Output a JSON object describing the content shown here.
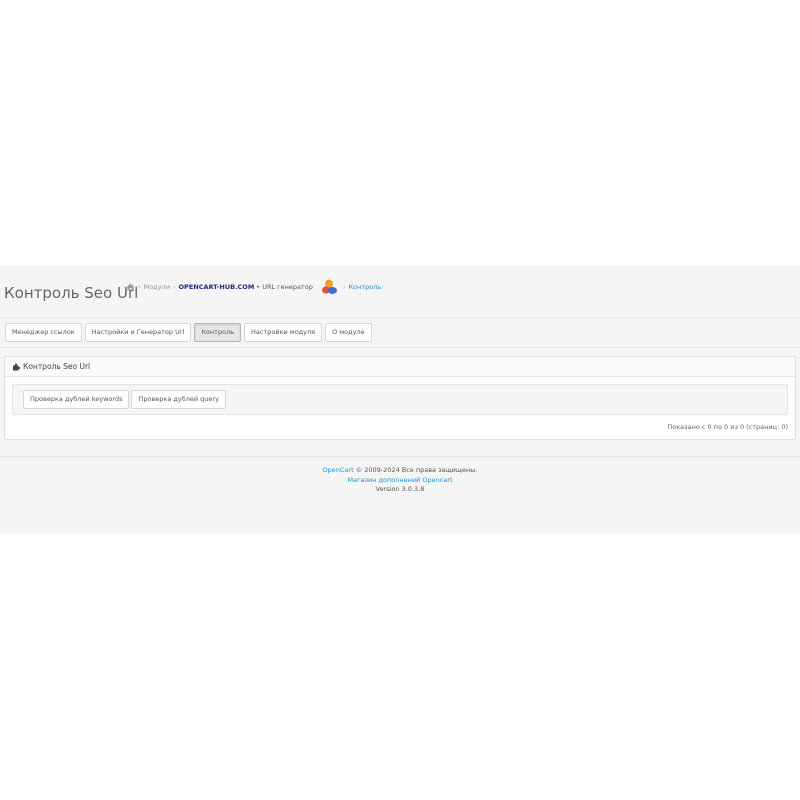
{
  "header": {
    "title": "Контроль Seo Url",
    "breadcrumb": {
      "home_icon": "home-icon",
      "modules": "Модули",
      "brand": "OPENCART-HUB.COM",
      "brand_rest": "• URL генератор",
      "logo_icon": "opencart-hub-logo-icon",
      "current": "Контроль"
    }
  },
  "tabs": [
    {
      "label": "Менеджер ссылок",
      "active": false
    },
    {
      "label": "Настройки и Генератор Url",
      "active": false
    },
    {
      "label": "Контроль",
      "active": true
    },
    {
      "label": "Настройки модуля",
      "active": false
    },
    {
      "label": "О модуле",
      "active": false
    }
  ],
  "panel": {
    "icon": "puzzle-icon",
    "title": "Контроль Seo Url",
    "buttons": {
      "keywords": "Проверка дублей keywords",
      "query": "Проверка дублей query"
    },
    "pagination": "Показано с 0 по 0 из 0 (страниц: 0)"
  },
  "footer": {
    "opencart_link": "OpenCart",
    "copyright": "© 2009-2024 Все права защищены.",
    "store_link": "Магазин дополнений Opencart",
    "version": "Version 3.0.3.8"
  },
  "colors": {
    "link": "#1e91cf",
    "brand": "#1f2a7a",
    "background": "#f5f5f5"
  }
}
